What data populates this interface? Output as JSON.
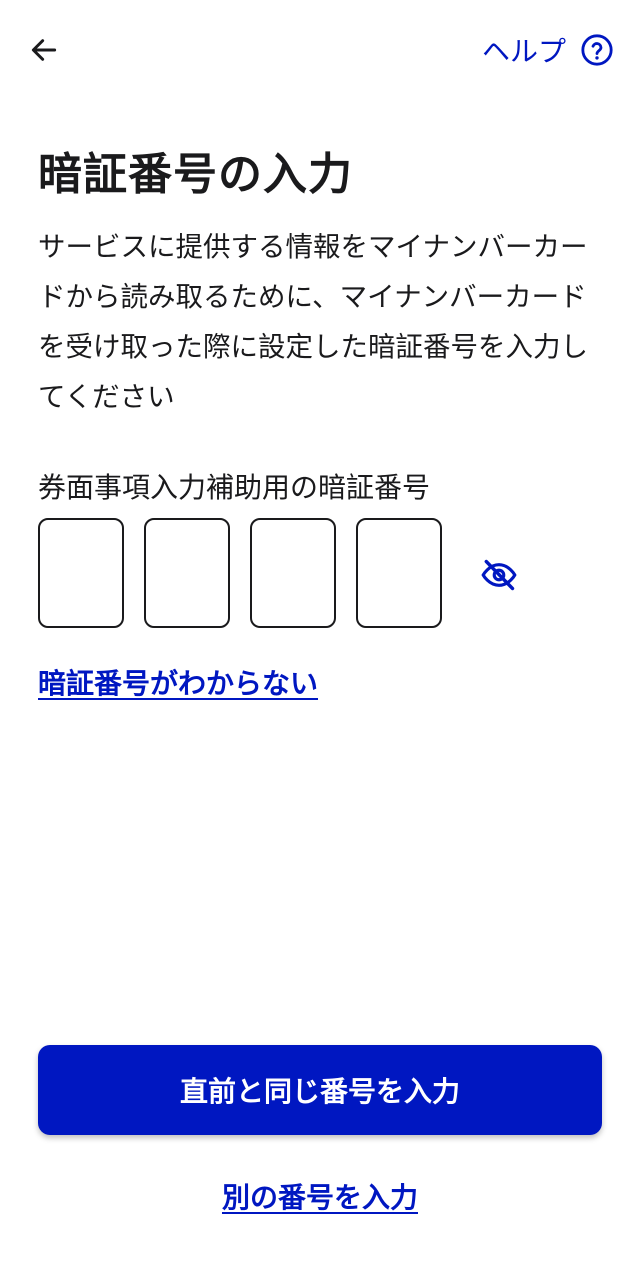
{
  "header": {
    "back_icon": "arrow-left-icon",
    "help_label": "ヘルプ",
    "help_icon": "question-circle-icon"
  },
  "main": {
    "title": "暗証番号の入力",
    "description": "サービスに提供する情報をマイナンバーカードから読み取るために、マイナンバーカードを受け取った際に設定した暗証番号を入力してください",
    "pin_label": "券面事項入力補助用の暗証番号",
    "pin_digits": [
      "",
      "",
      "",
      ""
    ],
    "visibility_icon": "eye-off-icon",
    "forgot_link": "暗証番号がわからない"
  },
  "footer": {
    "primary_button": "直前と同じ番号を入力",
    "secondary_link": "別の番号を入力"
  },
  "colors": {
    "accent": "#0017c1",
    "text": "#1a1a1c",
    "background": "#ffffff"
  }
}
